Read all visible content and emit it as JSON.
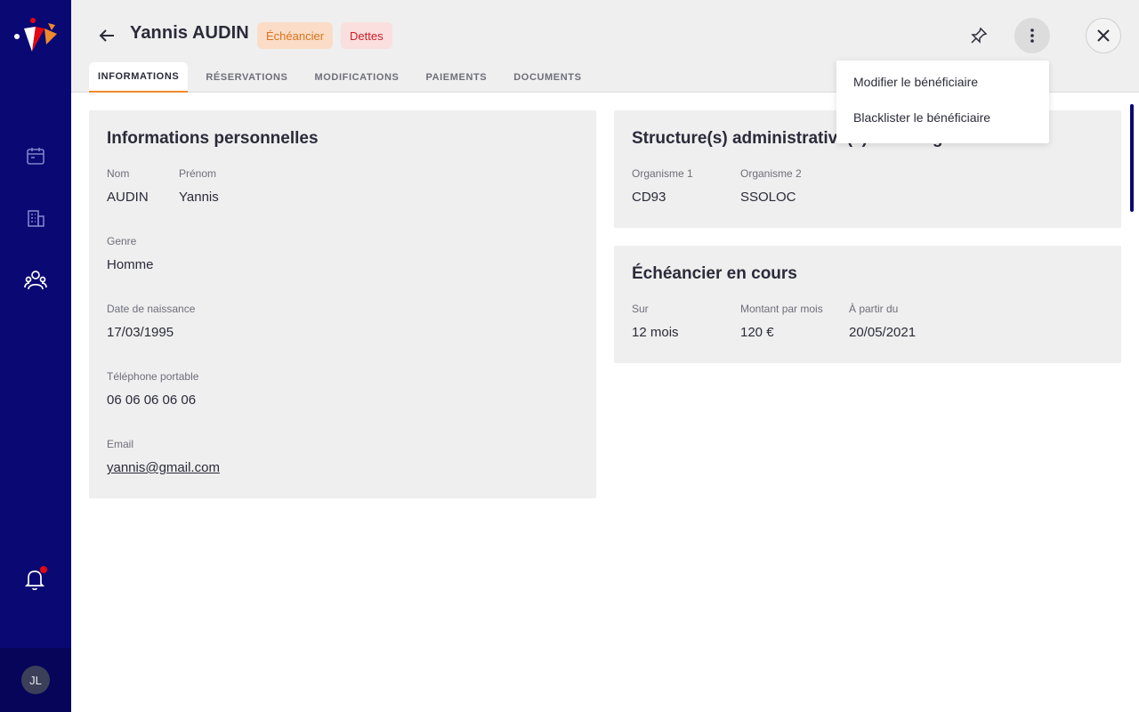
{
  "sidebar": {
    "nav": [
      "calendar-icon",
      "building-icon",
      "users-icon"
    ],
    "notifications_icon": "bell-icon",
    "avatar_initials": "JL"
  },
  "header": {
    "title": "Yannis AUDIN",
    "badges": [
      "Échéancier",
      "Dettes"
    ],
    "tabs": [
      "INFORMATIONS",
      "RÉSERVATIONS",
      "MODIFICATIONS",
      "PAIEMENTS",
      "DOCUMENTS"
    ],
    "active_tab": "INFORMATIONS"
  },
  "personal": {
    "title": "Informations personnelles",
    "nom_label": "Nom",
    "nom": "AUDIN",
    "prenom_label": "Prénom",
    "prenom": "Yannis",
    "genre_label": "Genre",
    "genre": "Homme",
    "naissance_label": "Date de naissance",
    "naissance": "17/03/1995",
    "tel_label": "Téléphone portable",
    "tel": "06 06 06 06 06",
    "email_label": "Email",
    "email": "yannis@gmail.com"
  },
  "structures": {
    "title": "Structure(s) administrative(s) en charge",
    "org1_label": "Organisme 1",
    "org1": "CD93",
    "org2_label": "Organisme 2",
    "org2": "SSOLOC"
  },
  "echeancier": {
    "title": "Échéancier en cours",
    "sur_label": "Sur",
    "sur": "12 mois",
    "montant_label": "Montant par mois",
    "montant": "120 €",
    "partir_label": "À partir du",
    "partir": "20/05/2021"
  },
  "menu": {
    "items": [
      "Modifier le bénéficiaire",
      "Blacklister le bénéficiaire"
    ]
  },
  "colors": {
    "sidebar": "#0a0873",
    "accent": "#f08a2a",
    "badge_orange": "#d9731a",
    "badge_red": "#c81d25"
  }
}
